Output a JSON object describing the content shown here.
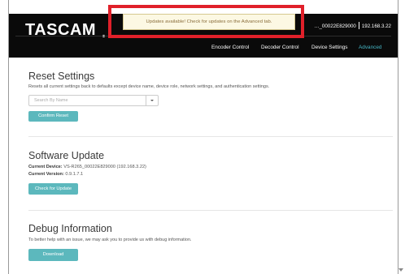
{
  "header": {
    "brand": "TASCAM",
    "device_name": "…_00022E829000",
    "device_ip": "192.168.3.22",
    "nav": [
      "Encoder Control",
      "Decoder Control",
      "Device Settings",
      "Advanced"
    ],
    "active_nav": "Advanced"
  },
  "alert": {
    "message": "Updates available! Check for updates on the Advanced tab."
  },
  "reset": {
    "title": "Reset Settings",
    "description": "Resets all current settings back to defaults except device name, device role, network settings, and authentication settings.",
    "search_placeholder": "Search By Name",
    "button": "Confirm Reset"
  },
  "software": {
    "title": "Software Update",
    "current_device_label": "Current Device:",
    "current_device_value": "VS-R265_00022E829000 (192.168.3.22)",
    "current_version_label": "Current Version:",
    "current_version_value": "0.9.1.7.1",
    "button": "Check for Update"
  },
  "debug": {
    "title": "Debug Information",
    "description": "To better help with an issue, we may ask you to provide us with debug information.",
    "button": "Download"
  },
  "colors": {
    "accent": "#5cb8bd",
    "active_nav": "#45b5c4",
    "alert_outline": "#e0202a",
    "alert_bg": "#fcf8e3",
    "topbar": "#0a0a0a"
  }
}
